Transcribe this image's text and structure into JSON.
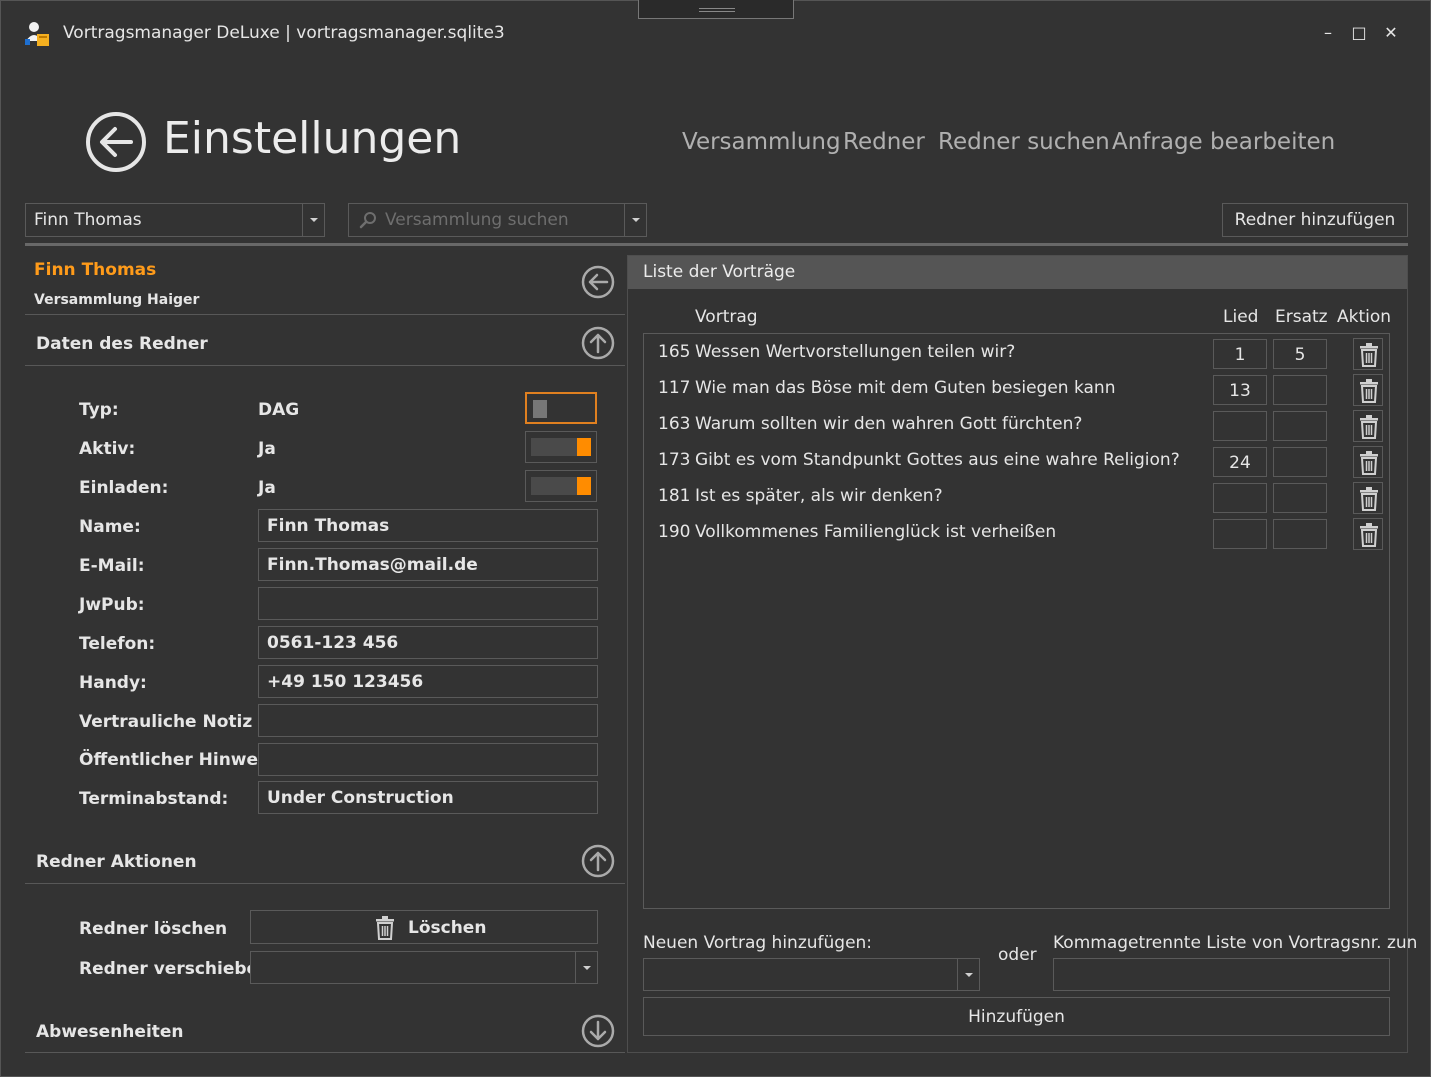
{
  "window": {
    "title": "Vortragsmanager DeLuxe | vortragsmanager.sqlite3",
    "minimize": "–",
    "maximize": "□",
    "close": "✕"
  },
  "header": {
    "title": "Einstellungen",
    "nav": [
      "Versammlung",
      "Redner",
      "Redner suchen",
      "Anfrage bearbeiten"
    ]
  },
  "toolbar": {
    "speaker_select": "Finn Thomas",
    "congregation_search_placeholder": "Versammlung suchen",
    "add_speaker_label": "Redner hinzufügen"
  },
  "speaker": {
    "name": "Finn Thomas",
    "congregation": "Versammlung Haiger"
  },
  "sections": {
    "data": "Daten des Redner",
    "actions": "Redner Aktionen",
    "absences": "Abwesenheiten"
  },
  "form": {
    "typ": {
      "label": "Typ:",
      "value": "DAG",
      "toggle": "off"
    },
    "aktiv": {
      "label": "Aktiv:",
      "value": "Ja",
      "toggle": "on"
    },
    "einladen": {
      "label": "Einladen:",
      "value": "Ja",
      "toggle": "on"
    },
    "name": {
      "label": "Name:",
      "value": "Finn Thomas"
    },
    "email": {
      "label": "E-Mail:",
      "value": "Finn.Thomas@mail.de"
    },
    "jwpub": {
      "label": "JwPub:",
      "value": ""
    },
    "telefon": {
      "label": "Telefon:",
      "value": "0561-123 456"
    },
    "handy": {
      "label": "Handy:",
      "value": "+49 150 123456"
    },
    "notiz": {
      "label": "Vertrauliche Notiz",
      "value": ""
    },
    "hinweis": {
      "label": "Öffentlicher Hinweis",
      "value": ""
    },
    "terminabstand": {
      "label": "Terminabstand:",
      "value": "Under Construction"
    }
  },
  "actions": {
    "delete_label": "Redner löschen",
    "delete_button": "Löschen",
    "move_label": "Redner verschieben",
    "move_value": ""
  },
  "talks": {
    "header": "Liste der Vorträge",
    "columns": {
      "talk": "Vortrag",
      "song": "Lied",
      "alt": "Ersatz",
      "action": "Aktion"
    },
    "rows": [
      {
        "num": "165",
        "title": "Wessen Wertvorstellungen teilen wir?",
        "song": "1",
        "alt": "5"
      },
      {
        "num": "117",
        "title": "Wie man das Böse mit dem Guten besiegen kann",
        "song": "13",
        "alt": ""
      },
      {
        "num": "163",
        "title": "Warum sollten wir den wahren Gott fürchten?",
        "song": "",
        "alt": ""
      },
      {
        "num": "173",
        "title": "Gibt es vom Standpunkt Gottes aus eine wahre Religion?",
        "song": "24",
        "alt": ""
      },
      {
        "num": "181",
        "title": "Ist es später, als wir denken?",
        "song": "",
        "alt": ""
      },
      {
        "num": "190",
        "title": "Vollkommenes Familienglück ist verheißen",
        "song": "",
        "alt": ""
      }
    ],
    "add_label": "Neuen Vortrag hinzufügen:",
    "or_label": "oder",
    "list_label": "Kommagetrennte Liste von Vortragsnr. zun",
    "add_button": "Hinzufügen"
  },
  "colors": {
    "accent": "#ff8c00",
    "background": "#333333",
    "border": "#5a5a5a"
  }
}
